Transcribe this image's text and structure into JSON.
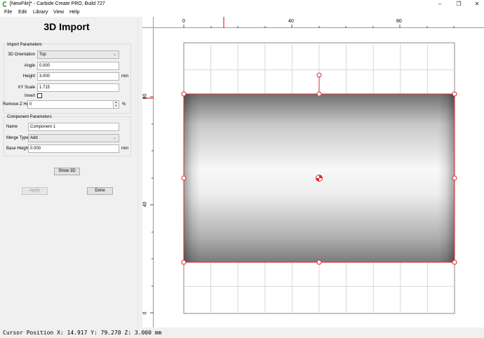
{
  "window": {
    "title": "[NewFile]* - Carbide Create PRO, Build 727",
    "controls": [
      "minimize-icon",
      "maximize-icon",
      "close-icon"
    ]
  },
  "menu": {
    "items": [
      "File",
      "Edit",
      "Library",
      "View",
      "Help"
    ]
  },
  "panel": {
    "title": "3D Import",
    "import_group": {
      "label": "Import Parameters",
      "orientation": {
        "label": "3D Orientation",
        "value": "Top"
      },
      "angle": {
        "label": "Angle",
        "value": "0.000"
      },
      "height": {
        "label": "Height",
        "value": "3.000",
        "unit": "mm"
      },
      "xy_scale": {
        "label": "XY Scale",
        "value": "1.715"
      },
      "invert": {
        "label": "Invert",
        "checked": false
      },
      "remove_z": {
        "label": "Remove Z Height",
        "value": "0",
        "unit": "%"
      }
    },
    "component_group": {
      "label": "Component Parameters",
      "name": {
        "label": "Name",
        "value": "Component 1"
      },
      "merge_type": {
        "label": "Merge Type",
        "value": "Add"
      },
      "base_height": {
        "label": "Base Height",
        "value": "0.000",
        "unit": "mm"
      }
    },
    "buttons": {
      "show3d": "Show 3D",
      "apply": "Apply",
      "done": "Done"
    }
  },
  "canvas": {
    "top_ruler_labels": [
      "0",
      "40",
      "80"
    ],
    "left_ruler_labels": [
      "80",
      "40",
      "0"
    ],
    "colors": {
      "selection": "#e0282a",
      "grid": "#d9d9d9",
      "border": "#888888"
    }
  },
  "status": {
    "cursor": "Cursor Position X: 14.917 Y: 79.270 Z: 3.000 mm"
  }
}
